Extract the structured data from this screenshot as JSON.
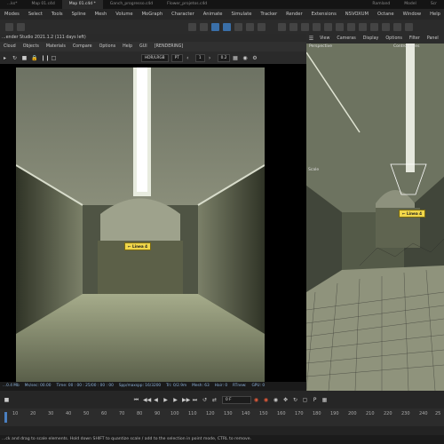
{
  "tabs": [
    "...ks*",
    "Map 01.c4d",
    "Map 01.c4d *",
    "Ganch_progresso.c4d",
    "Flower_projetos.c4d",
    "Ramland",
    "Model",
    "Scr"
  ],
  "menu": [
    "Modes",
    "Select",
    "Tools",
    "Spline",
    "Mesh",
    "Volume",
    "MoGraph",
    "Character",
    "Animate",
    "Simulate",
    "Tracker",
    "Render",
    "Extensions",
    "NSVOXUM",
    "Octane",
    "Window",
    "Help"
  ],
  "viewportA": {
    "title": "...ender Studio 2021.1.2 (111 days left)",
    "menu": [
      "Cloud",
      "Objects",
      "Materials",
      "Compare",
      "Options",
      "Help",
      "GUI",
      "[RENDERING]"
    ],
    "select_value": "HDR/LRGB",
    "select2_value": "PT",
    "num1": "1",
    "num2": "0.2",
    "sign_text": "← Linea 4"
  },
  "statusA": [
    "...0.4 Mb",
    "Ms/sec: 00.00",
    "Time: 00 : 00 : 25/00 : 00 : 00",
    "Spp/maxspp: 16/3200",
    "Tri: 0/2.9m",
    "Mesh: 63",
    "Hair: 0",
    "RTnew:",
    "GPU: 0"
  ],
  "viewportB": {
    "menu": [
      "View",
      "Cameras",
      "Display",
      "Options",
      "Filter",
      "Panel"
    ],
    "label": "Perspective",
    "label2": "Control Lines",
    "scale_label": "Scale",
    "sign_text": "← Linea 4"
  },
  "timeline": {
    "frame_value": "0 F",
    "ticks": [
      "10",
      "20",
      "30",
      "40",
      "50",
      "60",
      "70",
      "80",
      "90",
      "100",
      "110",
      "120",
      "130",
      "140",
      "150",
      "160",
      "170",
      "180",
      "190",
      "200",
      "210",
      "220",
      "230",
      "240",
      "25"
    ]
  },
  "help_text": "...ck and drag to scale elements. Hold down SHIFT to quantize scale / add to the selection in point mode, CTRL to remove."
}
